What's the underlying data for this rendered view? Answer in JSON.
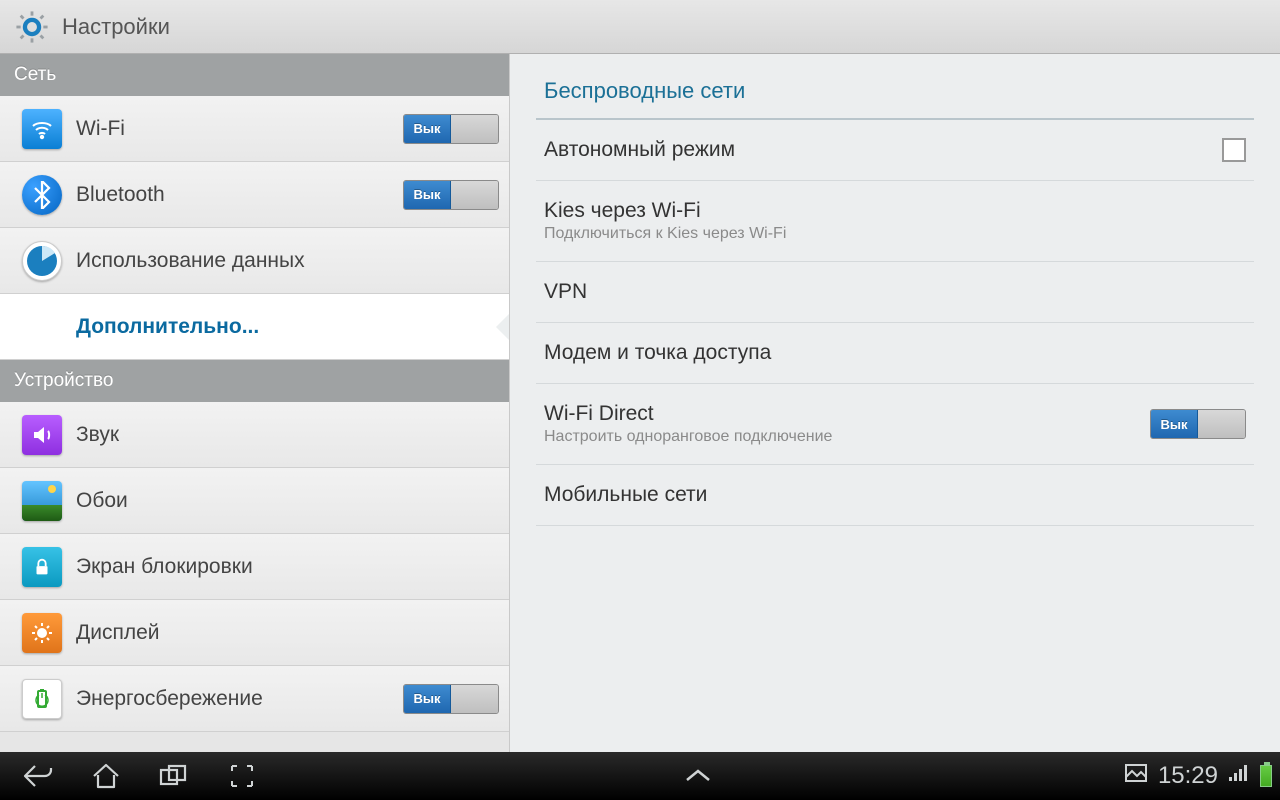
{
  "header": {
    "title": "Настройки"
  },
  "toggle_off_label": "Вык",
  "sidebar": {
    "sections": [
      {
        "title": "Сеть",
        "items": [
          {
            "id": "wifi",
            "label": "Wi-Fi",
            "icon": "wifi-icon",
            "toggle": true
          },
          {
            "id": "bluetooth",
            "label": "Bluetooth",
            "icon": "bluetooth-icon",
            "toggle": true
          },
          {
            "id": "data-usage",
            "label": "Использование данных",
            "icon": "data-usage-icon"
          },
          {
            "id": "more",
            "label": "Дополнительно...",
            "selected": true,
            "indent": true
          }
        ]
      },
      {
        "title": "Устройство",
        "items": [
          {
            "id": "sound",
            "label": "Звук",
            "icon": "sound-icon"
          },
          {
            "id": "wallpaper",
            "label": "Обои",
            "icon": "wallpaper-icon"
          },
          {
            "id": "lockscreen",
            "label": "Экран блокировки",
            "icon": "lock-icon"
          },
          {
            "id": "display",
            "label": "Дисплей",
            "icon": "display-icon"
          },
          {
            "id": "power",
            "label": "Энергосбережение",
            "icon": "power-saving-icon",
            "toggle": true
          }
        ]
      }
    ]
  },
  "detail": {
    "title": "Беспроводные сети",
    "items": [
      {
        "id": "airplane",
        "title": "Автономный режим",
        "checkbox": true
      },
      {
        "id": "kies",
        "title": "Kies через Wi-Fi",
        "sub": "Подключиться к Kies через Wi-Fi"
      },
      {
        "id": "vpn",
        "title": "VPN"
      },
      {
        "id": "tether",
        "title": "Модем и точка доступа"
      },
      {
        "id": "wifidirect",
        "title": "Wi-Fi Direct",
        "sub": "Настроить одноранговое подключение",
        "toggle": true
      },
      {
        "id": "mobile",
        "title": "Мобильные сети"
      }
    ]
  },
  "statusbar": {
    "time": "15:29"
  }
}
